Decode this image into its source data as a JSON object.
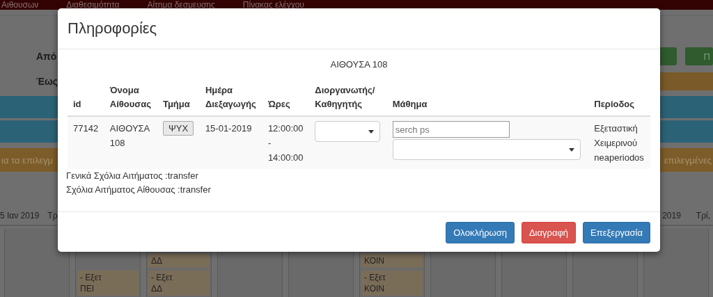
{
  "nav": {
    "items": [
      "Αιθουσων",
      "Διαθεσιμότητα",
      "Αίτημα δεσμευσης",
      "Πίνακας ελέγχου"
    ]
  },
  "filters": {
    "from_label": "Από",
    "to_label": "Έως",
    "right_button_label": "Π"
  },
  "banner": {
    "left_text": "ια τα επιλεγμ",
    "right_text": "επιλεγμένες"
  },
  "calendar": {
    "left_date": "5 Ιαν 2019",
    "left_day": "Τρ",
    "right_date": "2019",
    "right_day": "Τρί,",
    "columns": [
      {},
      {
        "bottom_event": {
          "lines": [
            "- Εξετ",
            "ΠΕΙ"
          ]
        }
      },
      {
        "top_event": {
          "lines": [
            "ΔΔ"
          ]
        },
        "bottom_event": {
          "lines": [
            "- Εξετ",
            "ΔΔ"
          ]
        }
      },
      {},
      {},
      {
        "top_event": {
          "lines": [
            "ΚΟΙΝ"
          ]
        },
        "bottom_event": {
          "lines": [
            "- Εξετ",
            "ΚΟΙΝ"
          ]
        }
      },
      {},
      {},
      {},
      {}
    ]
  },
  "modal": {
    "title": "Πληροφορίες",
    "room_heading": "ΑΙΘΟΥΣΑ 108",
    "columns": [
      {
        "lines": [
          "id"
        ]
      },
      {
        "lines": [
          "Όνομα",
          "Αίθουσας"
        ]
      },
      {
        "lines": [
          "Τμήμα"
        ]
      },
      {
        "lines": [
          "Ημέρα",
          "Διεξαγωγής"
        ]
      },
      {
        "lines": [
          "Ώρες"
        ]
      },
      {
        "lines": [
          "Διοργανωτής/",
          "Καθηγητής"
        ]
      },
      {
        "lines": [
          "Μάθημα"
        ]
      },
      {
        "lines": [
          "Περίοδος"
        ]
      }
    ],
    "row": {
      "id": "77142",
      "room": [
        "ΑΙΘΟΥΣΑ",
        "108"
      ],
      "department": "ΨΥΧ",
      "date": "15-01-2019",
      "hours": [
        "12:00:00",
        "-",
        "14:00:00"
      ],
      "course_search": {
        "placeholder": "serch ps"
      },
      "period": [
        "Εξεταστική",
        "Χειμερινού",
        "neaperiodos"
      ]
    },
    "comments": [
      "Γενικά Σχόλια Αιτήματος :transfer",
      "Σχόλια Αιτήματος Αίθουσας :transfer"
    ],
    "buttons": [
      {
        "label": "Ολοκλήρωση",
        "kind": "primary"
      },
      {
        "label": "Διαγραφή",
        "kind": "danger"
      },
      {
        "label": "Επεξεργασία",
        "kind": "primary"
      }
    ]
  }
}
